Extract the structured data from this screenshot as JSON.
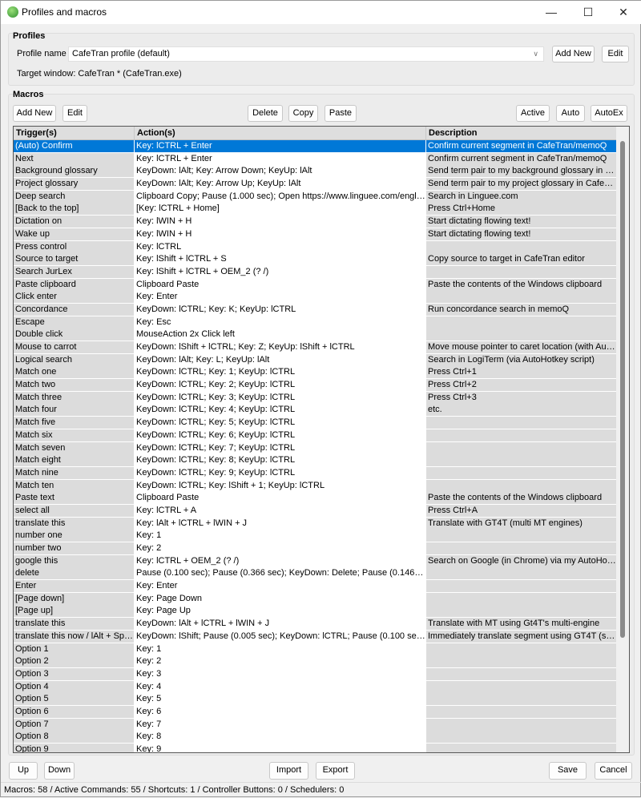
{
  "window": {
    "title": "Profiles and macros"
  },
  "profiles": {
    "heading": "Profiles",
    "profile_name_label": "Profile name",
    "profile_value": "CafeTran profile  (default)",
    "add_new": "Add New",
    "edit": "Edit",
    "target_window": "Target window: CafeTran * (CafeTran.exe)"
  },
  "macros": {
    "heading": "Macros",
    "add_new": "Add New",
    "edit": "Edit",
    "delete": "Delete",
    "copy": "Copy",
    "paste": "Paste",
    "active": "Active",
    "auto": "Auto",
    "autoex": "AutoEx"
  },
  "table": {
    "columns": [
      "Trigger(s)",
      "Action(s)",
      "Description"
    ],
    "selected_index": 0,
    "rows": [
      [
        "(Auto) Confirm",
        "Key: lCTRL + Enter",
        "Confirm current segment in CafeTran/memoQ"
      ],
      [
        "Next",
        "Key: lCTRL + Enter",
        "Confirm current segment in CafeTran/memoQ"
      ],
      [
        "Background glossary",
        "KeyDown: lAlt; Key: Arrow Down; KeyUp: lAlt",
        "Send term pair to my background glossary in Ca..."
      ],
      [
        "Project glossary",
        "KeyDown: lAlt; Key: Arrow Up; KeyUp: lAlt",
        "Send term pair to my project glossary in CafeTran"
      ],
      [
        "Deep search",
        "Clipboard Copy; Pause (1.000 sec); Open https://www.linguee.com/english-...",
        "Search in Linguee.com"
      ],
      [
        "[Back to the top]",
        "[Key: lCTRL + Home]",
        "Press Ctrl+Home"
      ],
      [
        "Dictation on",
        "Key: lWIN + H",
        "Start dictating flowing text!"
      ],
      [
        "Wake up",
        "Key: lWIN + H",
        "Start dictating flowing text!"
      ],
      [
        "Press control",
        "Key: lCTRL",
        ""
      ],
      [
        "Source to target",
        "Key: lShift + lCTRL + S",
        "Copy source to target in CafeTran editor"
      ],
      [
        "Search JurLex",
        "Key: lShift + lCTRL + OEM_2 (? /)",
        ""
      ],
      [
        "Paste clipboard",
        "Clipboard Paste",
        "Paste the contents of the Windows clipboard"
      ],
      [
        "Click enter",
        "Key: Enter",
        ""
      ],
      [
        "Concordance",
        "KeyDown: lCTRL; Key: K; KeyUp: lCTRL",
        "Run concordance search in memoQ"
      ],
      [
        "Escape",
        "Key: Esc",
        ""
      ],
      [
        "Double click",
        "MouseAction 2x Click left",
        ""
      ],
      [
        "Mouse to carrot",
        "KeyDown: lShift + lCTRL; Key: Z; KeyUp: lShift + lCTRL",
        "Move mouse pointer to caret location (with Auto..."
      ],
      [
        "Logical search",
        "KeyDown: lAlt; Key: L; KeyUp: lAlt",
        "Search in LogiTerm (via AutoHotkey script)"
      ],
      [
        "Match one",
        "KeyDown: lCTRL; Key: 1; KeyUp: lCTRL",
        "Press Ctrl+1"
      ],
      [
        "Match two",
        "KeyDown: lCTRL; Key: 2; KeyUp: lCTRL",
        "Press Ctrl+2"
      ],
      [
        "Match three",
        "KeyDown: lCTRL; Key: 3; KeyUp: lCTRL",
        "Press Ctrl+3"
      ],
      [
        "Match four",
        "KeyDown: lCTRL; Key: 4; KeyUp: lCTRL",
        "etc."
      ],
      [
        "Match five",
        "KeyDown: lCTRL; Key: 5; KeyUp: lCTRL",
        ""
      ],
      [
        "Match six",
        "KeyDown: lCTRL; Key: 6; KeyUp: lCTRL",
        ""
      ],
      [
        "Match seven",
        "KeyDown: lCTRL; Key: 7; KeyUp: lCTRL",
        ""
      ],
      [
        "Match eight",
        "KeyDown: lCTRL; Key: 8; KeyUp: lCTRL",
        ""
      ],
      [
        "Match nine",
        "KeyDown: lCTRL; Key: 9; KeyUp: lCTRL",
        ""
      ],
      [
        "Match ten",
        "KeyDown: lCTRL; Key: lShift + 1; KeyUp: lCTRL",
        ""
      ],
      [
        "Paste text",
        "Clipboard Paste",
        "Paste the contents of the Windows clipboard"
      ],
      [
        "select all",
        "Key: lCTRL + A",
        "Press Ctrl+A"
      ],
      [
        "translate this",
        "Key: lAlt + lCTRL + lWIN + J",
        "Translate with GT4T (multi MT engines)"
      ],
      [
        "number one",
        "Key: 1",
        ""
      ],
      [
        "number two",
        "Key: 2",
        ""
      ],
      [
        "google this",
        "Key: lCTRL + OEM_2 (? /)",
        "Search on Google (in Chrome) via my AutoHotk..."
      ],
      [
        "delete",
        "Pause (0.100 sec); Pause (0.366 sec); KeyDown: Delete; Pause (0.146 sec)...",
        ""
      ],
      [
        "Enter",
        "Key: Enter",
        ""
      ],
      [
        "[Page down]",
        "Key: Page Down",
        ""
      ],
      [
        "[Page up]",
        "Key: Page Up",
        ""
      ],
      [
        "translate this",
        "KeyDown: lAlt + lCTRL + lWIN + J",
        "Translate with MT using Gt4T's multi-engine"
      ],
      [
        "translate this now / lAlt + Space",
        "KeyDown: lShift; Pause (0.005 sec); KeyDown: lCTRL; Pause (0.100 sec); K...",
        "Immediately translate segment using GT4T (singl..."
      ],
      [
        "Option 1",
        "Key: 1",
        ""
      ],
      [
        "Option 2",
        "Key: 2",
        ""
      ],
      [
        "Option 3",
        "Key: 3",
        ""
      ],
      [
        "Option 4",
        "Key: 4",
        ""
      ],
      [
        "Option 5",
        "Key: 5",
        ""
      ],
      [
        "Option 6",
        "Key: 6",
        ""
      ],
      [
        "Option 7",
        "Key: 7",
        ""
      ],
      [
        "Option 8",
        "Key: 8",
        ""
      ],
      [
        "Option 9",
        "Key: 9",
        ""
      ]
    ]
  },
  "footer": {
    "up": "Up",
    "down": "Down",
    "import": "Import",
    "export": "Export",
    "save": "Save",
    "cancel": "Cancel"
  },
  "status": "Macros: 58 / Active Commands: 55 / Shortcuts: 1 / Controller Buttons: 0 / Schedulers: 0",
  "colors": {
    "selection": "#0078d7",
    "cell_grey": "#dcdcdc"
  }
}
